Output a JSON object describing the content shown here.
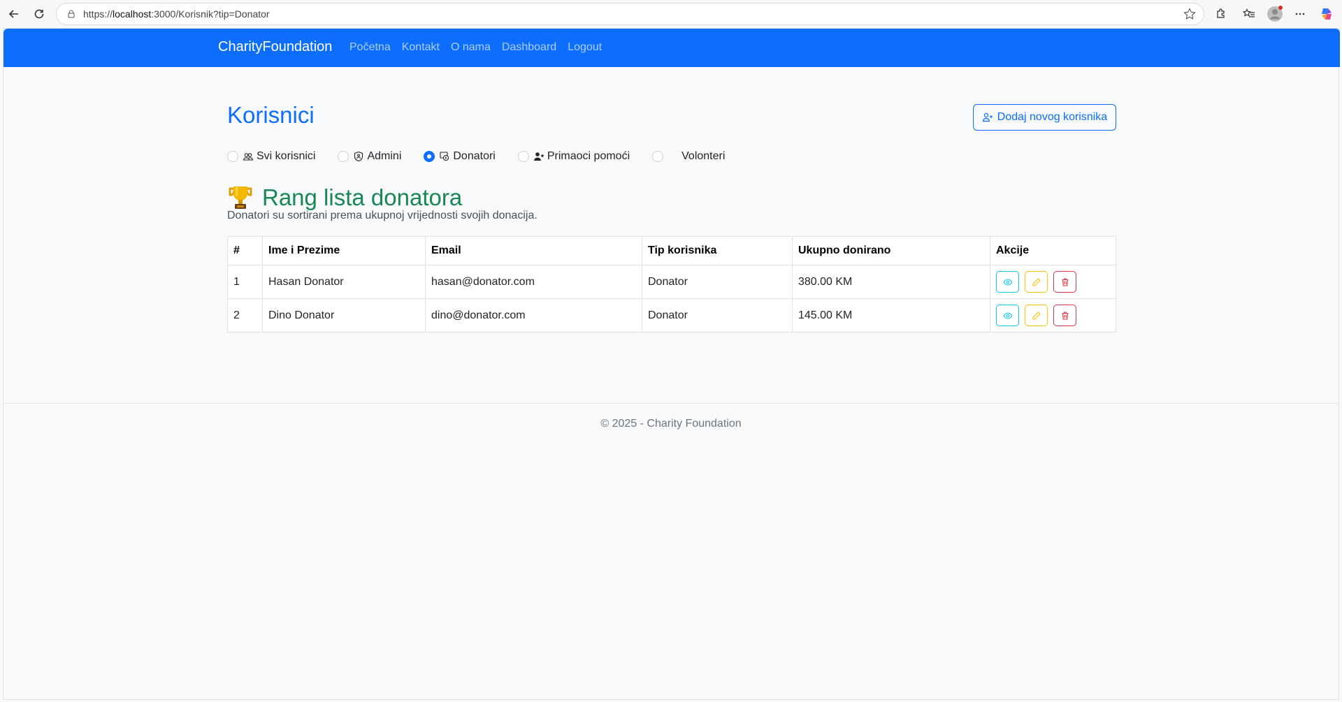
{
  "browser": {
    "url_prefix": "https://",
    "url_host": "localhost",
    "url_rest": ":3000/Korisnik?tip=Donator"
  },
  "navbar": {
    "brand": "CharityFoundation",
    "links": [
      "Početna",
      "Kontakt",
      "O nama",
      "Dashboard",
      "Logout"
    ]
  },
  "main": {
    "title": "Korisnici",
    "add_button": "Dodaj novog korisnika",
    "filters": [
      {
        "label": "Svi korisnici",
        "checked": false
      },
      {
        "label": "Admini",
        "checked": false
      },
      {
        "label": "Donatori",
        "checked": true
      },
      {
        "label": "Primaoci pomoći",
        "checked": false
      },
      {
        "label": "Volonteri",
        "checked": false
      }
    ],
    "rank_title": "Rang lista donatora",
    "rank_description": "Donatori su sortirani prema ukupnoj vrijednosti svojih donacija."
  },
  "table": {
    "headers": [
      "#",
      "Ime i Prezime",
      "Email",
      "Tip korisnika",
      "Ukupno donirano",
      "Akcije"
    ],
    "rows": [
      [
        "1",
        "Hasan Donator",
        "hasan@donator.com",
        "Donator",
        "380.00 KM"
      ],
      [
        "2",
        "Dino Donator",
        "dino@donator.com",
        "Donator",
        "145.00 KM"
      ]
    ]
  },
  "footer": {
    "text": "© 2025 - Charity Foundation"
  },
  "colors": {
    "primary": "#0d6efd",
    "success": "#198754",
    "info": "#0dcaf0",
    "warning": "#ffc107",
    "danger": "#dc3545"
  },
  "icons": {
    "back": "arrow-left-icon",
    "reload": "reload-icon",
    "lock": "lock-icon",
    "star": "star-icon",
    "extensions": "puzzle-icon",
    "favorites": "favorites-icon",
    "profile": "profile-icon",
    "menu": "more-icon",
    "copilot": "copilot-icon",
    "add_user": "person-plus-icon",
    "all_users": "people-icon",
    "admins": "shield-icon",
    "donors": "donor-icon",
    "recipients": "person-plus-fill-icon",
    "trophy": "trophy-icon",
    "view": "eye-icon",
    "edit": "pencil-icon",
    "delete": "trash-icon"
  }
}
